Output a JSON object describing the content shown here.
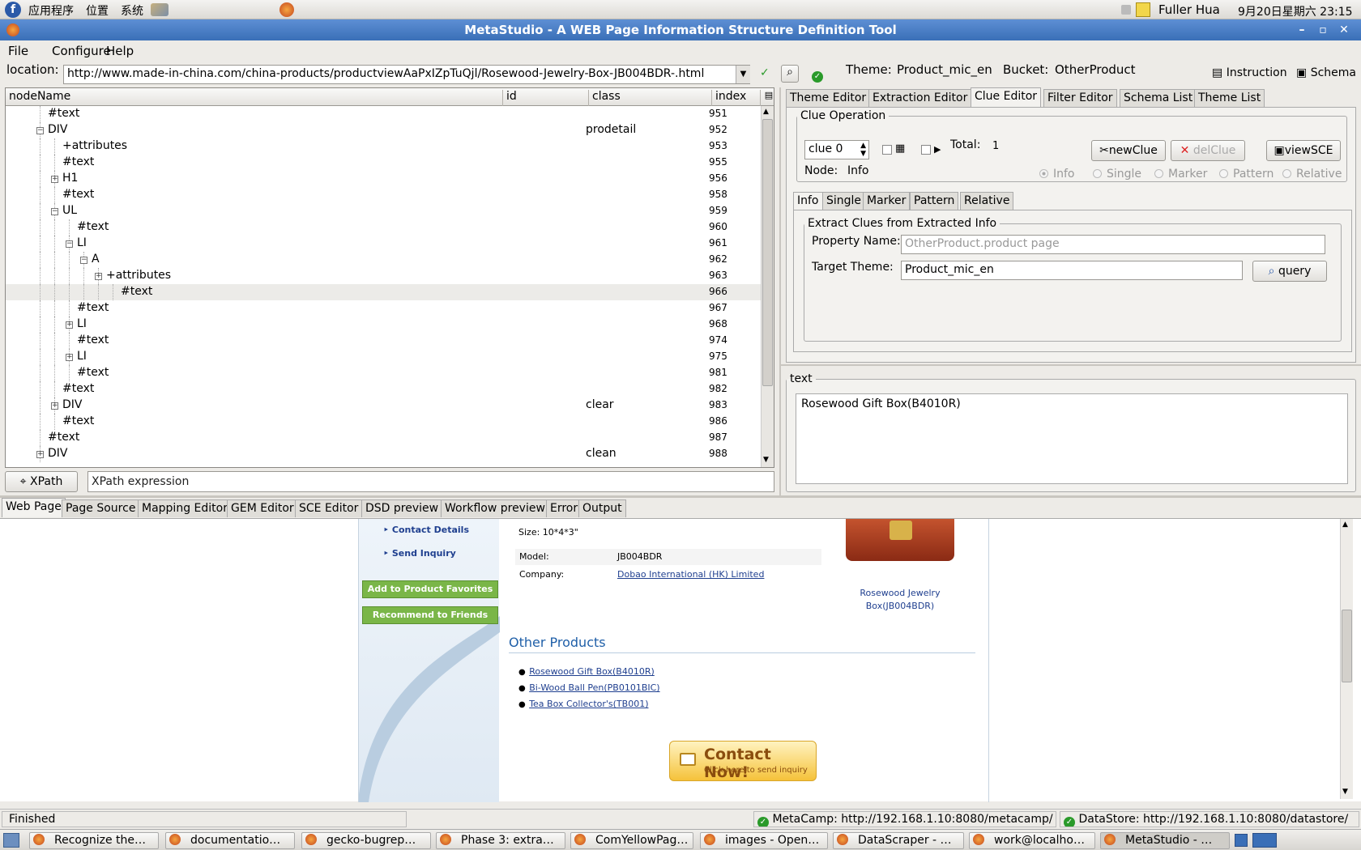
{
  "gnome_panel": {
    "menus": [
      "应用程序",
      "位置",
      "系统"
    ],
    "user": "Fuller Hua",
    "clock": "9月20日星期六 23:15"
  },
  "window": {
    "title": "MetaStudio - A WEB Page Information Structure Definition Tool"
  },
  "menubar": [
    "File",
    "Configure",
    "Help"
  ],
  "location": {
    "label": "location:",
    "url": "http://www.made-in-china.com/china-products/productviewAaPxIZpTuQjl/Rosewood-Jewelry-Box-JB004BDR-.html",
    "theme_label": "Theme:",
    "theme_value": "Product_mic_en",
    "bucket_label": "Bucket:",
    "bucket_value": "OtherProduct",
    "instruction": "Instruction",
    "schema": "Schema"
  },
  "tree": {
    "columns": [
      "nodeName",
      "id",
      "class",
      "index"
    ],
    "rows": [
      {
        "name": "#text",
        "class": "",
        "index": "951"
      },
      {
        "name": "DIV",
        "class": "prodetail",
        "index": "952"
      },
      {
        "name": "+attributes",
        "class": "",
        "index": "953"
      },
      {
        "name": "#text",
        "class": "",
        "index": "955"
      },
      {
        "name": "H1",
        "class": "",
        "index": "956"
      },
      {
        "name": "#text",
        "class": "",
        "index": "958"
      },
      {
        "name": "UL",
        "class": "",
        "index": "959"
      },
      {
        "name": "#text",
        "class": "",
        "index": "960"
      },
      {
        "name": "LI",
        "class": "",
        "index": "961"
      },
      {
        "name": "A",
        "class": "",
        "index": "962"
      },
      {
        "name": "+attributes",
        "class": "",
        "index": "963"
      },
      {
        "name": "#text",
        "class": "",
        "index": "966"
      },
      {
        "name": "#text",
        "class": "",
        "index": "967"
      },
      {
        "name": "LI",
        "class": "",
        "index": "968"
      },
      {
        "name": "#text",
        "class": "",
        "index": "974"
      },
      {
        "name": "LI",
        "class": "",
        "index": "975"
      },
      {
        "name": "#text",
        "class": "",
        "index": "981"
      },
      {
        "name": "#text",
        "class": "",
        "index": "982"
      },
      {
        "name": "DIV",
        "class": "clear",
        "index": "983"
      },
      {
        "name": "#text",
        "class": "",
        "index": "986"
      },
      {
        "name": "#text",
        "class": "",
        "index": "987"
      },
      {
        "name": "DIV",
        "class": "clean",
        "index": "988"
      }
    ]
  },
  "xpath": {
    "button": "XPath",
    "placeholder": "XPath expression"
  },
  "editor_tabs": [
    "Theme Editor",
    "Extraction Editor",
    "Clue Editor",
    "Filter Editor",
    "Schema List",
    "Theme List"
  ],
  "clue": {
    "legend": "Clue Operation",
    "selector": "clue 0",
    "total_label": "Total:",
    "total_value": "1",
    "new_button": "newClue",
    "del_button": "delClue",
    "view_button": "viewSCE",
    "node_label": "Node:",
    "node_value": "Info",
    "radios": [
      "Info",
      "Single",
      "Marker",
      "Pattern",
      "Relative"
    ],
    "subtabs": [
      "Info",
      "Single",
      "Marker",
      "Pattern",
      "Relative"
    ],
    "extract_legend": "Extract Clues from Extracted Info",
    "property_label": "Property Name:",
    "property_placeholder": "OtherProduct.product page",
    "target_label": "Target Theme:",
    "target_value": "Product_mic_en",
    "query_button": "query"
  },
  "text_panel": {
    "legend": "text",
    "value": "Rosewood Gift Box(B4010R)"
  },
  "bottom_tabs": [
    "Web Page",
    "Page Source",
    "Mapping Editor",
    "GEM Editor",
    "SCE Editor",
    "DSD preview",
    "Workflow preview",
    "Error",
    "Output"
  ],
  "webpage": {
    "side_links": [
      "Contact Details",
      "Send Inquiry"
    ],
    "side_buttons": [
      "Add to Product Favorites",
      "Recommend to Friends"
    ],
    "size_text": "Size: 10*4*3\"",
    "model_label": "Model:",
    "model_value": "JB004BDR",
    "company_label": "Company:",
    "company_value": "Dobao International (HK) Limited",
    "image_caption": "Rosewood Jewelry Box(JB004BDR)",
    "other_title": "Other Products",
    "other_items": [
      "Rosewood Gift Box(B4010R)",
      "Bi-Wood Ball Pen(PB0101BIC)",
      "Tea Box Collector's(TB001)"
    ],
    "contact_title": "Contact Now!",
    "contact_sub": "Click here to send inquiry"
  },
  "status": {
    "left": "Finished",
    "metacamp": "MetaCamp: http://192.168.1.10:8080/metacamp/",
    "datastore": "DataStore: http://192.168.1.10:8080/datastore/"
  },
  "taskbar": [
    "Recognize the…",
    "documentatio…",
    "gecko-bugrep…",
    "Phase 3: extra…",
    "ComYellowPag…",
    "images - Open…",
    "DataScraper - …",
    "work@localho…",
    "MetaStudio - …"
  ],
  "colors": {
    "titlebar": "#3a6fb7",
    "selected_tab": "#f3f2ef",
    "link": "#1f3f8f",
    "green_button": "#7ab648"
  }
}
